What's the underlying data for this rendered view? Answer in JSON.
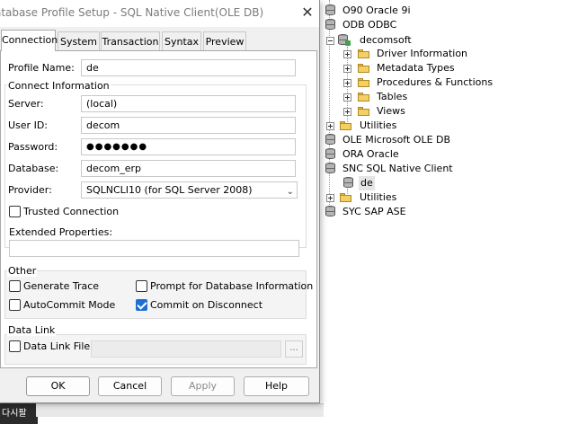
{
  "dialog": {
    "title": "atabase Profile Setup - SQL Native Client(OLE DB)",
    "tabs": [
      "Connection",
      "System",
      "Transaction",
      "Syntax",
      "Preview"
    ],
    "profile_name_label": "Profile Name:",
    "profile_name_value": "de",
    "connect_group_title": "Connect Information",
    "server_label": "Server:",
    "server_value": "(local)",
    "userid_label": "User ID:",
    "userid_value": "decom",
    "password_label": "Password:",
    "password_value": "●●●●●●●",
    "database_label": "Database:",
    "database_value": "decom_erp",
    "provider_label": "Provider:",
    "provider_value": "SQLNCLI10 (for SQL Server 2008)",
    "trusted_connection_label": "Trusted Connection",
    "trusted_connection_checked": false,
    "extended_properties_label": "Extended Properties:",
    "extended_properties_value": "",
    "other_group_title": "Other",
    "generate_trace_label": "Generate Trace",
    "prompt_db_info_label": "Prompt for Database Information",
    "autocommit_label": "AutoCommit Mode",
    "commit_on_disconnect_label": "Commit on Disconnect",
    "commit_on_disconnect_checked": true,
    "datalink_group_title": "Data Link",
    "datalink_file_label": "Data Link File:",
    "ellipsis_label": "...",
    "buttons": {
      "ok": "OK",
      "cancel": "Cancel",
      "apply": "Apply",
      "help": "Help"
    }
  },
  "tree": {
    "items": [
      {
        "label": "O90 Oracle 9i",
        "icon": "database-icon"
      },
      {
        "label": "ODB ODBC",
        "icon": "database-icon"
      },
      {
        "label": "decomsoft",
        "icon": "database-profile-icon"
      },
      {
        "label": "Driver Information",
        "icon": "folder-icon"
      },
      {
        "label": "Metadata Types",
        "icon": "folder-icon"
      },
      {
        "label": "Procedures & Functions",
        "icon": "folder-icon"
      },
      {
        "label": "Tables",
        "icon": "folder-icon"
      },
      {
        "label": "Views",
        "icon": "folder-icon"
      },
      {
        "label": "Utilities",
        "icon": "folder-icon"
      },
      {
        "label": "OLE Microsoft OLE DB",
        "icon": "database-icon"
      },
      {
        "label": "ORA Oracle",
        "icon": "database-icon"
      },
      {
        "label": "SNC SQL Native Client",
        "icon": "database-icon"
      },
      {
        "label": "de",
        "icon": "database-icon"
      },
      {
        "label": "Utilities",
        "icon": "folder-icon"
      },
      {
        "label": "SYC SAP ASE",
        "icon": "database-icon"
      }
    ]
  },
  "taskbar": {
    "text": "다시팔"
  }
}
